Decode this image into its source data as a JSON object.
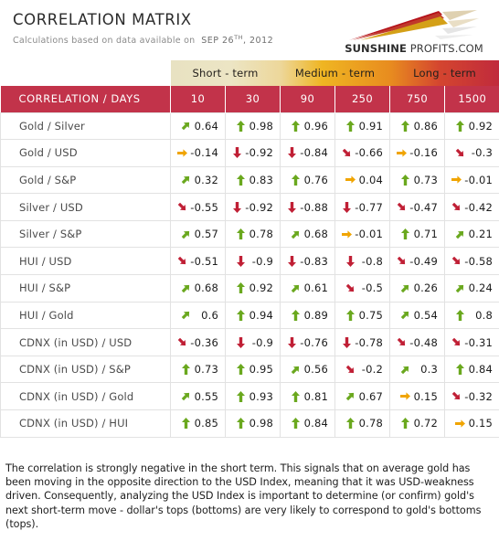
{
  "header": {
    "title": "CORRELATION MATRIX",
    "subtitle_prefix": "Calculations based on data available on",
    "date_main": "SEP 26",
    "date_ordinal": "TH",
    "date_rest": ", 2012",
    "logo": {
      "brand_bold": "SUNSHINE",
      "brand_light": " PROFITS.COM",
      "colors": {
        "ray_red": "#b5121b",
        "ray_crimson": "#c0392b",
        "ray_gold": "#d4a017",
        "ray_tan": "#d9c9a3",
        "ray_pale": "#efe7d2"
      }
    }
  },
  "table": {
    "terms": [
      {
        "label": "Short - term",
        "span": 2,
        "style": "grad-short"
      },
      {
        "label": "Medium - term",
        "span": 2,
        "style": "grad-medium"
      },
      {
        "label": "Long - term",
        "span": 2,
        "style": "grad-long"
      }
    ],
    "corner_header": "CORRELATION / DAYS",
    "day_headers": [
      "10",
      "30",
      "90",
      "250",
      "750",
      "1500"
    ],
    "header_color": "#c2334a",
    "arrow_colors": {
      "up": "#6aa81e",
      "up-right": "#6aa81e",
      "right": "#f0a400",
      "down-right": "#c01f35",
      "down": "#c01f35"
    },
    "rows": [
      {
        "label": "Gold / Silver",
        "cells": [
          {
            "value": "0.64",
            "arrow": "up-right"
          },
          {
            "value": "0.98",
            "arrow": "up"
          },
          {
            "value": "0.96",
            "arrow": "up"
          },
          {
            "value": "0.91",
            "arrow": "up"
          },
          {
            "value": "0.86",
            "arrow": "up"
          },
          {
            "value": "0.92",
            "arrow": "up"
          }
        ]
      },
      {
        "label": "Gold / USD",
        "cells": [
          {
            "value": "-0.14",
            "arrow": "right"
          },
          {
            "value": "-0.92",
            "arrow": "down"
          },
          {
            "value": "-0.84",
            "arrow": "down"
          },
          {
            "value": "-0.66",
            "arrow": "down-right"
          },
          {
            "value": "-0.16",
            "arrow": "right"
          },
          {
            "value": "-0.3",
            "arrow": "down-right"
          }
        ]
      },
      {
        "label": "Gold / S&P",
        "cells": [
          {
            "value": "0.32",
            "arrow": "up-right"
          },
          {
            "value": "0.83",
            "arrow": "up"
          },
          {
            "value": "0.76",
            "arrow": "up"
          },
          {
            "value": "0.04",
            "arrow": "right"
          },
          {
            "value": "0.73",
            "arrow": "up"
          },
          {
            "value": "-0.01",
            "arrow": "right"
          }
        ]
      },
      {
        "label": "Silver / USD",
        "cells": [
          {
            "value": "-0.55",
            "arrow": "down-right"
          },
          {
            "value": "-0.92",
            "arrow": "down"
          },
          {
            "value": "-0.88",
            "arrow": "down"
          },
          {
            "value": "-0.77",
            "arrow": "down"
          },
          {
            "value": "-0.47",
            "arrow": "down-right"
          },
          {
            "value": "-0.42",
            "arrow": "down-right"
          }
        ]
      },
      {
        "label": "Silver / S&P",
        "cells": [
          {
            "value": "0.57",
            "arrow": "up-right"
          },
          {
            "value": "0.78",
            "arrow": "up"
          },
          {
            "value": "0.68",
            "arrow": "up-right"
          },
          {
            "value": "-0.01",
            "arrow": "right"
          },
          {
            "value": "0.71",
            "arrow": "up"
          },
          {
            "value": "0.21",
            "arrow": "up-right"
          }
        ]
      },
      {
        "label": "HUI / USD",
        "cells": [
          {
            "value": "-0.51",
            "arrow": "down-right"
          },
          {
            "value": "-0.9",
            "arrow": "down"
          },
          {
            "value": "-0.83",
            "arrow": "down"
          },
          {
            "value": "-0.8",
            "arrow": "down"
          },
          {
            "value": "-0.49",
            "arrow": "down-right"
          },
          {
            "value": "-0.58",
            "arrow": "down-right"
          }
        ]
      },
      {
        "label": "HUI / S&P",
        "cells": [
          {
            "value": "0.68",
            "arrow": "up-right"
          },
          {
            "value": "0.92",
            "arrow": "up"
          },
          {
            "value": "0.61",
            "arrow": "up-right"
          },
          {
            "value": "-0.5",
            "arrow": "down-right"
          },
          {
            "value": "0.26",
            "arrow": "up-right"
          },
          {
            "value": "0.24",
            "arrow": "up-right"
          }
        ]
      },
      {
        "label": "HUI / Gold",
        "cells": [
          {
            "value": "0.6",
            "arrow": "up-right"
          },
          {
            "value": "0.94",
            "arrow": "up"
          },
          {
            "value": "0.89",
            "arrow": "up"
          },
          {
            "value": "0.75",
            "arrow": "up"
          },
          {
            "value": "0.54",
            "arrow": "up-right"
          },
          {
            "value": "0.8",
            "arrow": "up"
          }
        ]
      },
      {
        "label": "CDNX (in USD) / USD",
        "cells": [
          {
            "value": "-0.36",
            "arrow": "down-right"
          },
          {
            "value": "-0.9",
            "arrow": "down"
          },
          {
            "value": "-0.76",
            "arrow": "down"
          },
          {
            "value": "-0.78",
            "arrow": "down"
          },
          {
            "value": "-0.48",
            "arrow": "down-right"
          },
          {
            "value": "-0.31",
            "arrow": "down-right"
          }
        ]
      },
      {
        "label": "CDNX (in USD) / S&P",
        "cells": [
          {
            "value": "0.73",
            "arrow": "up"
          },
          {
            "value": "0.95",
            "arrow": "up"
          },
          {
            "value": "0.56",
            "arrow": "up-right"
          },
          {
            "value": "-0.2",
            "arrow": "down-right"
          },
          {
            "value": "0.3",
            "arrow": "up-right"
          },
          {
            "value": "0.84",
            "arrow": "up"
          }
        ]
      },
      {
        "label": "CDNX (in USD) / Gold",
        "cells": [
          {
            "value": "0.55",
            "arrow": "up-right"
          },
          {
            "value": "0.93",
            "arrow": "up"
          },
          {
            "value": "0.81",
            "arrow": "up"
          },
          {
            "value": "0.67",
            "arrow": "up-right"
          },
          {
            "value": "0.15",
            "arrow": "right"
          },
          {
            "value": "-0.32",
            "arrow": "down-right"
          }
        ]
      },
      {
        "label": "CDNX (in USD) / HUI",
        "cells": [
          {
            "value": "0.85",
            "arrow": "up"
          },
          {
            "value": "0.98",
            "arrow": "up"
          },
          {
            "value": "0.84",
            "arrow": "up"
          },
          {
            "value": "0.78",
            "arrow": "up"
          },
          {
            "value": "0.72",
            "arrow": "up"
          },
          {
            "value": "0.15",
            "arrow": "right"
          }
        ]
      }
    ]
  },
  "footer": {
    "text": "The correlation is strongly negative in the short term. This signals that on average gold has been moving in the opposite direction to the USD Index, meaning that it was USD-weakness driven. Consequently, analyzing the USD Index is important to determine (or confirm) gold's next short-term move - dollar's tops (bottoms) are very likely to correspond to gold's bottoms (tops)."
  }
}
